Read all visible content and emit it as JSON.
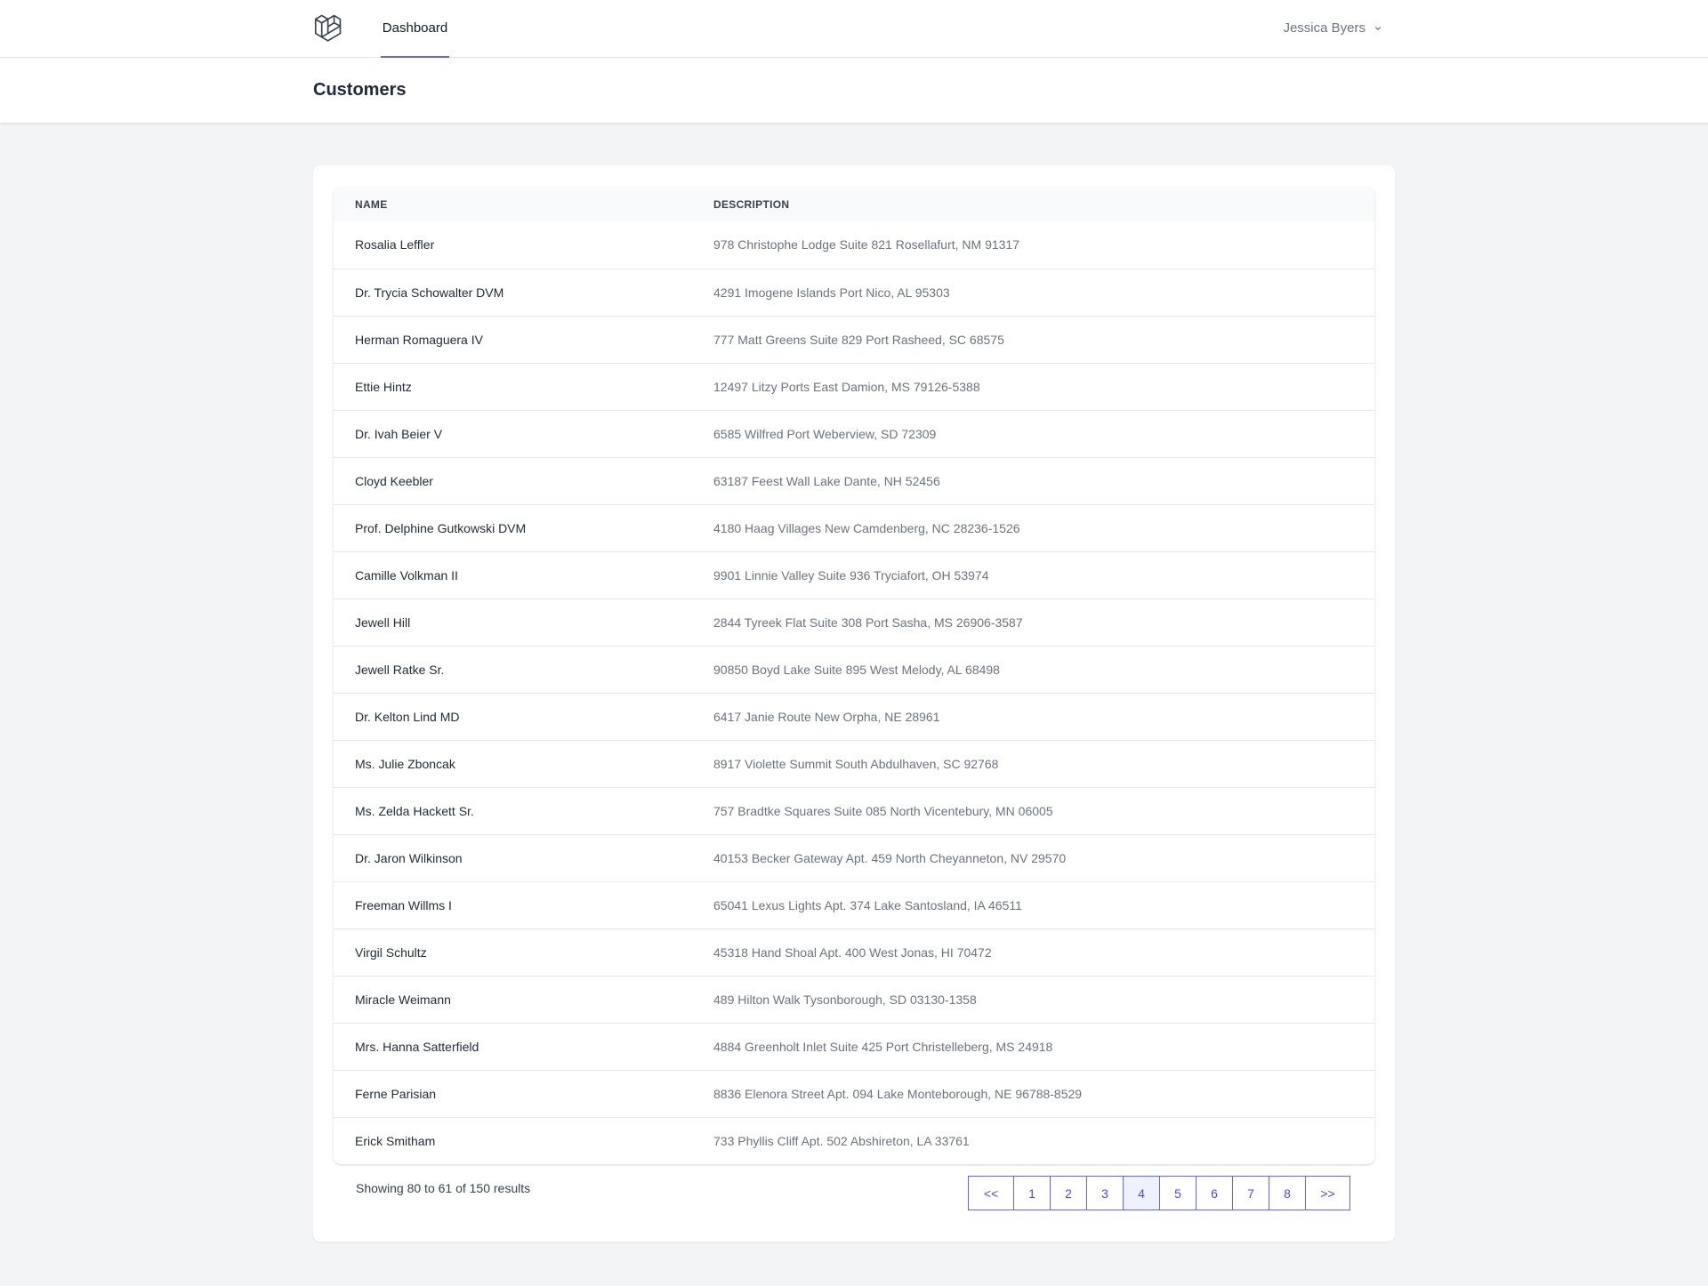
{
  "nav": {
    "logo_icon": "laravel-logo-icon",
    "dashboard_label": "Dashboard",
    "user_name": "Jessica Byers",
    "user_menu_icon": "chevron-down-icon",
    "accent_color": "#6366f1"
  },
  "header": {
    "title": "Customers"
  },
  "table": {
    "columns": [
      "NAME",
      "DESCRIPTION"
    ],
    "rows": [
      {
        "name": "Rosalia Leffler",
        "description": "978 Christophe Lodge Suite 821 Rosellafurt, NM 91317"
      },
      {
        "name": "Dr. Trycia Schowalter DVM",
        "description": "4291 Imogene Islands Port Nico, AL 95303"
      },
      {
        "name": "Herman Romaguera IV",
        "description": "777 Matt Greens Suite 829 Port Rasheed, SC 68575"
      },
      {
        "name": "Ettie Hintz",
        "description": "12497 Litzy Ports East Damion, MS 79126-5388"
      },
      {
        "name": "Dr. Ivah Beier V",
        "description": "6585 Wilfred Port Weberview, SD 72309"
      },
      {
        "name": "Cloyd Keebler",
        "description": "63187 Feest Wall Lake Dante, NH 52456"
      },
      {
        "name": "Prof. Delphine Gutkowski DVM",
        "description": "4180 Haag Villages New Camdenberg, NC 28236-1526"
      },
      {
        "name": "Camille Volkman II",
        "description": "9901 Linnie Valley Suite 936 Tryciafort, OH 53974"
      },
      {
        "name": "Jewell Hill",
        "description": "2844 Tyreek Flat Suite 308 Port Sasha, MS 26906-3587"
      },
      {
        "name": "Jewell Ratke Sr.",
        "description": "90850 Boyd Lake Suite 895 West Melody, AL 68498"
      },
      {
        "name": "Dr. Kelton Lind MD",
        "description": "6417 Janie Route New Orpha, NE 28961"
      },
      {
        "name": "Ms. Julie Zboncak",
        "description": "8917 Violette Summit South Abdulhaven, SC 92768"
      },
      {
        "name": "Ms. Zelda Hackett Sr.",
        "description": "757 Bradtke Squares Suite 085 North Vicentebury, MN 06005"
      },
      {
        "name": "Dr. Jaron Wilkinson",
        "description": "40153 Becker Gateway Apt. 459 North Cheyanneton, NV 29570"
      },
      {
        "name": "Freeman Willms I",
        "description": "65041 Lexus Lights Apt. 374 Lake Santosland, IA 46511"
      },
      {
        "name": "Virgil Schultz",
        "description": "45318 Hand Shoal Apt. 400 West Jonas, HI 70472"
      },
      {
        "name": "Miracle Weimann",
        "description": "489 Hilton Walk Tysonborough, SD 03130-1358"
      },
      {
        "name": "Mrs. Hanna Satterfield",
        "description": "4884 Greenholt Inlet Suite 425 Port Christelleberg, MS 24918"
      },
      {
        "name": "Ferne Parisian",
        "description": "8836 Elenora Street Apt. 094 Lake Monteborough, NE 96788-8529"
      },
      {
        "name": "Erick Smitham",
        "description": "733 Phyllis Cliff Apt. 502 Abshireton, LA 33761"
      }
    ]
  },
  "pagination": {
    "results_text": "Showing 80 to 61 of 150 results",
    "prev_label": "<<",
    "next_label": ">>",
    "pages": [
      "1",
      "2",
      "3",
      "4",
      "5",
      "6",
      "7",
      "8"
    ],
    "current_page": "4"
  }
}
